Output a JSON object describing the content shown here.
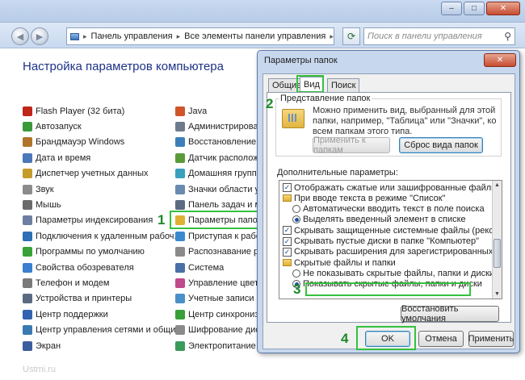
{
  "window": {
    "minimize_icon": "‒",
    "maximize_icon": "□",
    "close_icon": "✕"
  },
  "address": {
    "back_icon": "◀",
    "forward_icon": "▶",
    "separator": "▸",
    "crumbs": [
      "Панель управления",
      "Все элементы панели управления"
    ],
    "refresh_icon": "⟳",
    "search_placeholder": "Поиск в панели управления",
    "search_icon": "⚲"
  },
  "heading": "Настройка параметров компьютера",
  "left_items": [
    {
      "label": "Flash Player (32 бита)",
      "color": "#c0261a"
    },
    {
      "label": "Автозапуск",
      "color": "#3a9a3a"
    },
    {
      "label": "Брандмауэр Windows",
      "color": "#b0752a"
    },
    {
      "label": "Дата и время",
      "color": "#4a78b8"
    },
    {
      "label": "Диспетчер учетных данных",
      "color": "#c59b2a"
    },
    {
      "label": "Звук",
      "color": "#8b8b8b"
    },
    {
      "label": "Мышь",
      "color": "#6b6b6b"
    },
    {
      "label": "Параметры индексирования",
      "color": "#6c7fa0"
    },
    {
      "label": "Подключения к удаленным рабоч...",
      "color": "#2f6fb5"
    },
    {
      "label": "Программы по умолчанию",
      "color": "#38a138"
    },
    {
      "label": "Свойства обозревателя",
      "color": "#3a7fd0"
    },
    {
      "label": "Телефон и модем",
      "color": "#7a7a7a"
    },
    {
      "label": "Устройства и принтеры",
      "color": "#5a6a80"
    },
    {
      "label": "Центр поддержки",
      "color": "#3262b0"
    },
    {
      "label": "Центр управления сетями и общи...",
      "color": "#3a7ab0"
    },
    {
      "label": "Экран",
      "color": "#3b5f9e"
    }
  ],
  "right_items": [
    {
      "label": "Java",
      "color": "#d0542a"
    },
    {
      "label": "Администрирование",
      "color": "#6e7b8e"
    },
    {
      "label": "Восстановление",
      "color": "#3c7fb8"
    },
    {
      "label": "Датчик расположения",
      "color": "#5a9a3a"
    },
    {
      "label": "Домашняя группа",
      "color": "#3aa0c0"
    },
    {
      "label": "Значки области уведомлений",
      "color": "#6a8ab0"
    },
    {
      "label": "Панель задач и меню",
      "color": "#5a6a80"
    },
    {
      "label": "Параметры папок",
      "color": "#e0b032"
    },
    {
      "label": "Приступая к работе",
      "color": "#3a8ad0"
    },
    {
      "label": "Распознавание речи",
      "color": "#8a8a8a"
    },
    {
      "label": "Система",
      "color": "#4a70a8"
    },
    {
      "label": "Управление цветом",
      "color": "#c04a8a"
    },
    {
      "label": "Учетные записи пользователей",
      "color": "#4a90c8"
    },
    {
      "label": "Центр синхронизации",
      "color": "#38a038"
    },
    {
      "label": "Шифрование диска BitLocker",
      "color": "#8a8a8a"
    },
    {
      "label": "Электропитание",
      "color": "#3a9a5a"
    }
  ],
  "step_labels": {
    "one": "1",
    "two": "2",
    "three": "3",
    "four": "4"
  },
  "dialog": {
    "title": "Параметры папок",
    "close_icon": "✕",
    "tabs": [
      "Общие",
      "Вид",
      "Поиск"
    ],
    "group_title": "Представление папок",
    "description": "Можно применить вид, выбранный для этой папки, например, \"Таблица\" или \"Значки\", ко всем папкам этого типа.",
    "apply_button": "Применить к папкам",
    "reset_button": "Сброс вида папок",
    "advanced_label": "Дополнительные параметры:",
    "options": [
      {
        "type": "check",
        "checked": true,
        "label": "Отображать сжатые или зашифрованные файлы NTI",
        "indent": 1
      },
      {
        "type": "folder",
        "label": "При вводе текста в режиме \"Список\"",
        "indent": 1
      },
      {
        "type": "radio",
        "checked": false,
        "label": "Автоматически вводить текст в поле поиска",
        "indent": 2
      },
      {
        "type": "radio",
        "checked": true,
        "label": "Выделять введенный элемент в списке",
        "indent": 2
      },
      {
        "type": "check",
        "checked": true,
        "label": "Скрывать защищенные системные файлы (рекомен",
        "indent": 1
      },
      {
        "type": "check",
        "checked": true,
        "label": "Скрывать пустые диски в папке \"Компьютер\"",
        "indent": 1
      },
      {
        "type": "check",
        "checked": true,
        "label": "Скрывать расширения для зарегистрированных типо",
        "indent": 1
      },
      {
        "type": "folder",
        "label": "Скрытые файлы и папки",
        "indent": 1
      },
      {
        "type": "radio",
        "checked": false,
        "label": "Не показывать скрытые файлы, папки и диски",
        "indent": 2
      },
      {
        "type": "radio",
        "checked": true,
        "label": "Показывать скрытые файлы, папки и диски",
        "indent": 2
      }
    ],
    "scroll_up_icon": "▲",
    "scroll_down_icon": "▼",
    "restore_button": "Восстановить умолчания",
    "ok_button": "OK",
    "cancel_button": "Отмена",
    "apply_footer_button": "Применить"
  },
  "watermark": "Ustmi.ru",
  "highlight_color": "#35c13e"
}
